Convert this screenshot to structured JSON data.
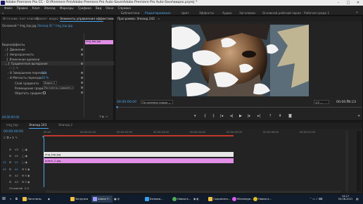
{
  "titlebar": {
    "title": "Adobe Premiere Pro CC - D:\\Premiere Pro\\Adobe Premiere Pro Auto-Save\\Adobe Premiere Pro Auto-Save\\видео.prproj *"
  },
  "menu": [
    "Файл",
    "Правка",
    "Клип",
    "Эпизод",
    "Маркеры",
    "Графика",
    "Вид",
    "Окно",
    "Справка"
  ],
  "workspaces": {
    "items": [
      "Библиотеки",
      "Редактирование",
      "Цвет",
      "Эффекты",
      "Аудио",
      "Заголовки",
      "Основной рабочий экран",
      "Рабочая среда 1"
    ],
    "active_index": 1
  },
  "left_panel": {
    "tabs": [
      "Источник: (нет клипов)",
      "Проект: видео",
      "Элементы управления эффектами"
    ],
    "clip_header": "Основной * img_top.jpg",
    "clip_header2": "Эпизод 02 * img_top.jpg",
    "clip_label": "img_top.jpg",
    "section": "Видеоэффекты",
    "rows": [
      "Движение",
      "Непрозрачность",
      "Изменение времени",
      "Градиентное вытирание"
    ],
    "subrows": [
      "Завершение перехода",
      "Мягкость перехода",
      "Слой градиента",
      "Размещение градиен...",
      "Обратить градиент"
    ],
    "transition_value": "0 %",
    "softness_value": "10 %",
    "layer_value": "Видео 2",
    "placement_value": "Растянуть градиент п",
    "timecode": "00:00:00:00"
  },
  "program": {
    "title": "Программа: Эпизод 243",
    "timecode_left": "00:00:00:00",
    "fit": "По размеру кадра",
    "quality": "1/2",
    "timecode_right": "00:00:04:23"
  },
  "timeline": {
    "tabs": [
      "img_top",
      "Эпизод 243",
      "Эпизод 2"
    ],
    "timecode": "00:00:00:00",
    "ruler": [
      "00:00",
      "00:00:01:00",
      "00:00:02:00",
      "00:00:03:00",
      "00:00:04:00",
      "00:00:05:00",
      "00:00:06:00",
      "00:00:07:00"
    ],
    "tracks": [
      "V3",
      "V2",
      "V1",
      "A1",
      "A2",
      "A3",
      "Основной"
    ],
    "clips": [
      {
        "name": "img_top.jpg",
        "color": "#e7e7e7"
      },
      {
        "name": "priem_2.jpg",
        "color": "#e38ee6"
      }
    ]
  },
  "taskbar": {
    "items": [
      "Логотипы",
      "Загрузки",
      "Adobe P...",
      "Безымя...",
      "Новая в...",
      "Сохранить...",
      "Messenge...",
      "Новая в..."
    ],
    "time": "14:17",
    "date": "03.06.2021"
  },
  "colors": {
    "accent": "#4aa3e8",
    "playhead": "#4aa3e8",
    "clip_white": "#e7e7e7",
    "clip_pink": "#e38ee6"
  }
}
